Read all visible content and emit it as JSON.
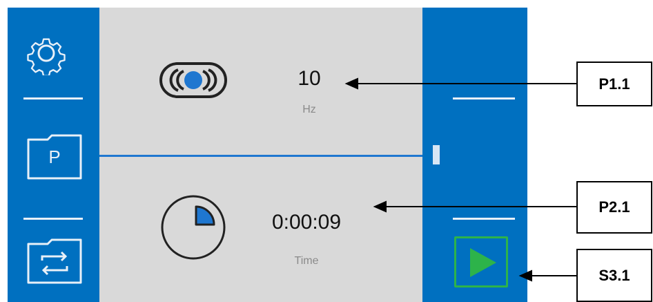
{
  "sidebar": {
    "items": [
      {
        "icon": "gear-icon"
      },
      {
        "icon": "folder-icon",
        "letter": "P"
      },
      {
        "icon": "folder-swap-icon"
      }
    ]
  },
  "params": [
    {
      "value": "10",
      "unit": "Hz",
      "icon": "vibration-icon"
    },
    {
      "value": "0:00:09",
      "unit": "Time",
      "icon": "timer-icon"
    }
  ],
  "controls": {
    "play_icon": "play-icon",
    "play_color": "#2db34a"
  },
  "callouts": [
    {
      "label": "P1.1"
    },
    {
      "label": "P2.1"
    },
    {
      "label": "S3.1"
    }
  ],
  "colors": {
    "panel_blue": "#0070c0",
    "panel_grey": "#d9d9d9",
    "accent_blue": "#1f77d0"
  }
}
